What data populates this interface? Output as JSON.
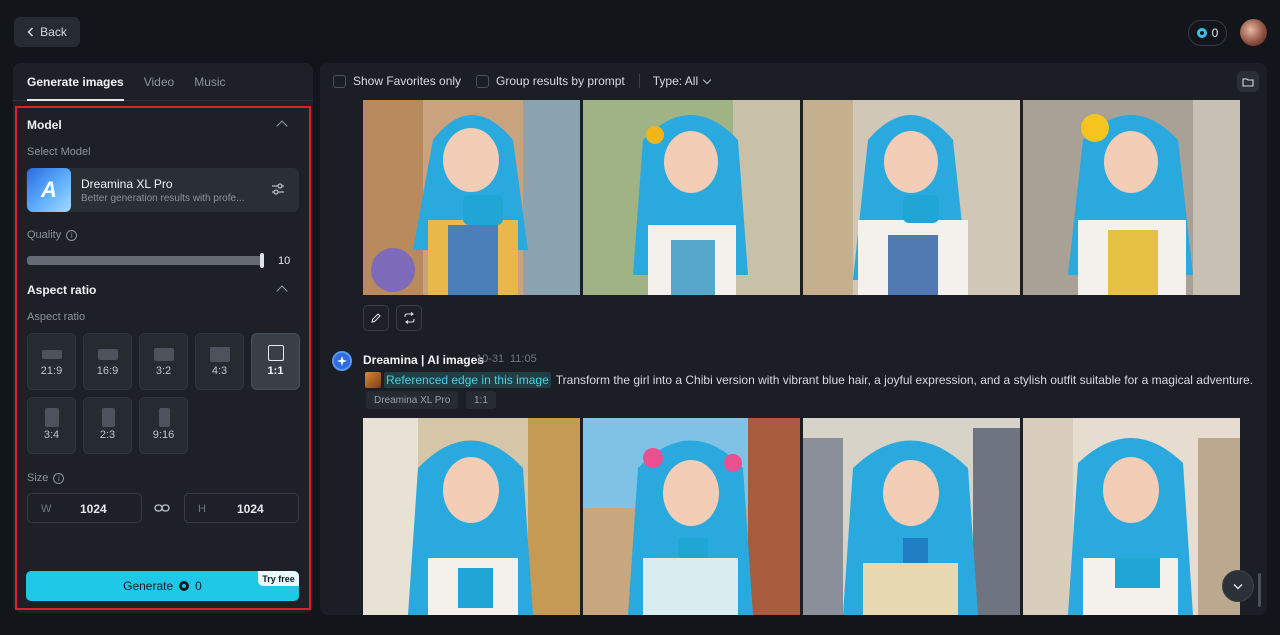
{
  "header": {
    "back_label": "Back",
    "credits": "0"
  },
  "left_panel": {
    "tabs": [
      {
        "label": "Generate images",
        "active": true
      },
      {
        "label": "Video",
        "active": false
      },
      {
        "label": "Music",
        "active": false
      }
    ],
    "model_section": {
      "title": "Model",
      "select_label": "Select Model",
      "model_name": "Dreamina XL Pro",
      "model_desc": "Better generation results with profe...",
      "quality_label": "Quality",
      "quality_value": "10"
    },
    "aspect_section": {
      "title": "Aspect ratio",
      "label": "Aspect ratio",
      "options": [
        "21:9",
        "16:9",
        "3:2",
        "4:3",
        "1:1",
        "3:4",
        "2:3",
        "9:16"
      ],
      "selected": "1:1"
    },
    "size": {
      "label": "Size",
      "w_prefix": "W",
      "w_value": "1024",
      "h_prefix": "H",
      "h_value": "1024"
    },
    "generate": {
      "label": "Generate",
      "cost": "0",
      "badge": "Try free"
    }
  },
  "results": {
    "toolbar": {
      "favorites_label": "Show Favorites only",
      "group_label": "Group results by prompt",
      "type_label": "Type: All"
    },
    "entry": {
      "author": "Dreamina | AI images",
      "date": "10-31",
      "time": "11:05",
      "reference_chip": "Referenced edge in this image",
      "prompt": "Transform the girl into a Chibi version with vibrant blue hair, a joyful expression, and a stylish outfit suitable for a magical adventure.",
      "tags": [
        "Dreamina XL Pro",
        "1:1"
      ]
    }
  },
  "colors": {
    "accent": "#20c8e8",
    "selection_outline": "#e11d2a",
    "hair_blue": "#2aa9de"
  }
}
